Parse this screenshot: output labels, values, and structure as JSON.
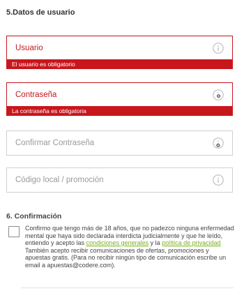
{
  "sections": {
    "user_data_title": "5.Datos de usuario",
    "confirmation_title": "6. Confirmación"
  },
  "fields": {
    "username": {
      "label": "Usuario",
      "error": "El usuario es obligatorio",
      "icon": "info-icon"
    },
    "password": {
      "label": "Contraseña",
      "error": "La contraseña es obligatoria",
      "icon": "info-icon"
    },
    "confirm_password": {
      "label": "Confirmar Contraseña",
      "icon": "info-icon"
    },
    "promo_code": {
      "label": "Código local / promoción",
      "icon": "info-icon"
    }
  },
  "consent": {
    "text_before": "Confirmo que tengo más de 18 años, que no padezco ninguna enfermedad mental que haya sido declarada interdicta judicialmente y que he leído, entiendo y acepto las ",
    "terms_link": "condiciones generales",
    "text_middle": " y la ",
    "privacy_link": "política de privacidad",
    "text_after": "También acepto recibir comunicaciones de ofertas, promociones y apuestas gratis. (Para no recibir ningún tipo de comunicación escribe un email a apuestas@codere.com)."
  },
  "colors": {
    "error": "#c8161d",
    "link": "#7cae1f",
    "border": "#cfcfcf"
  }
}
